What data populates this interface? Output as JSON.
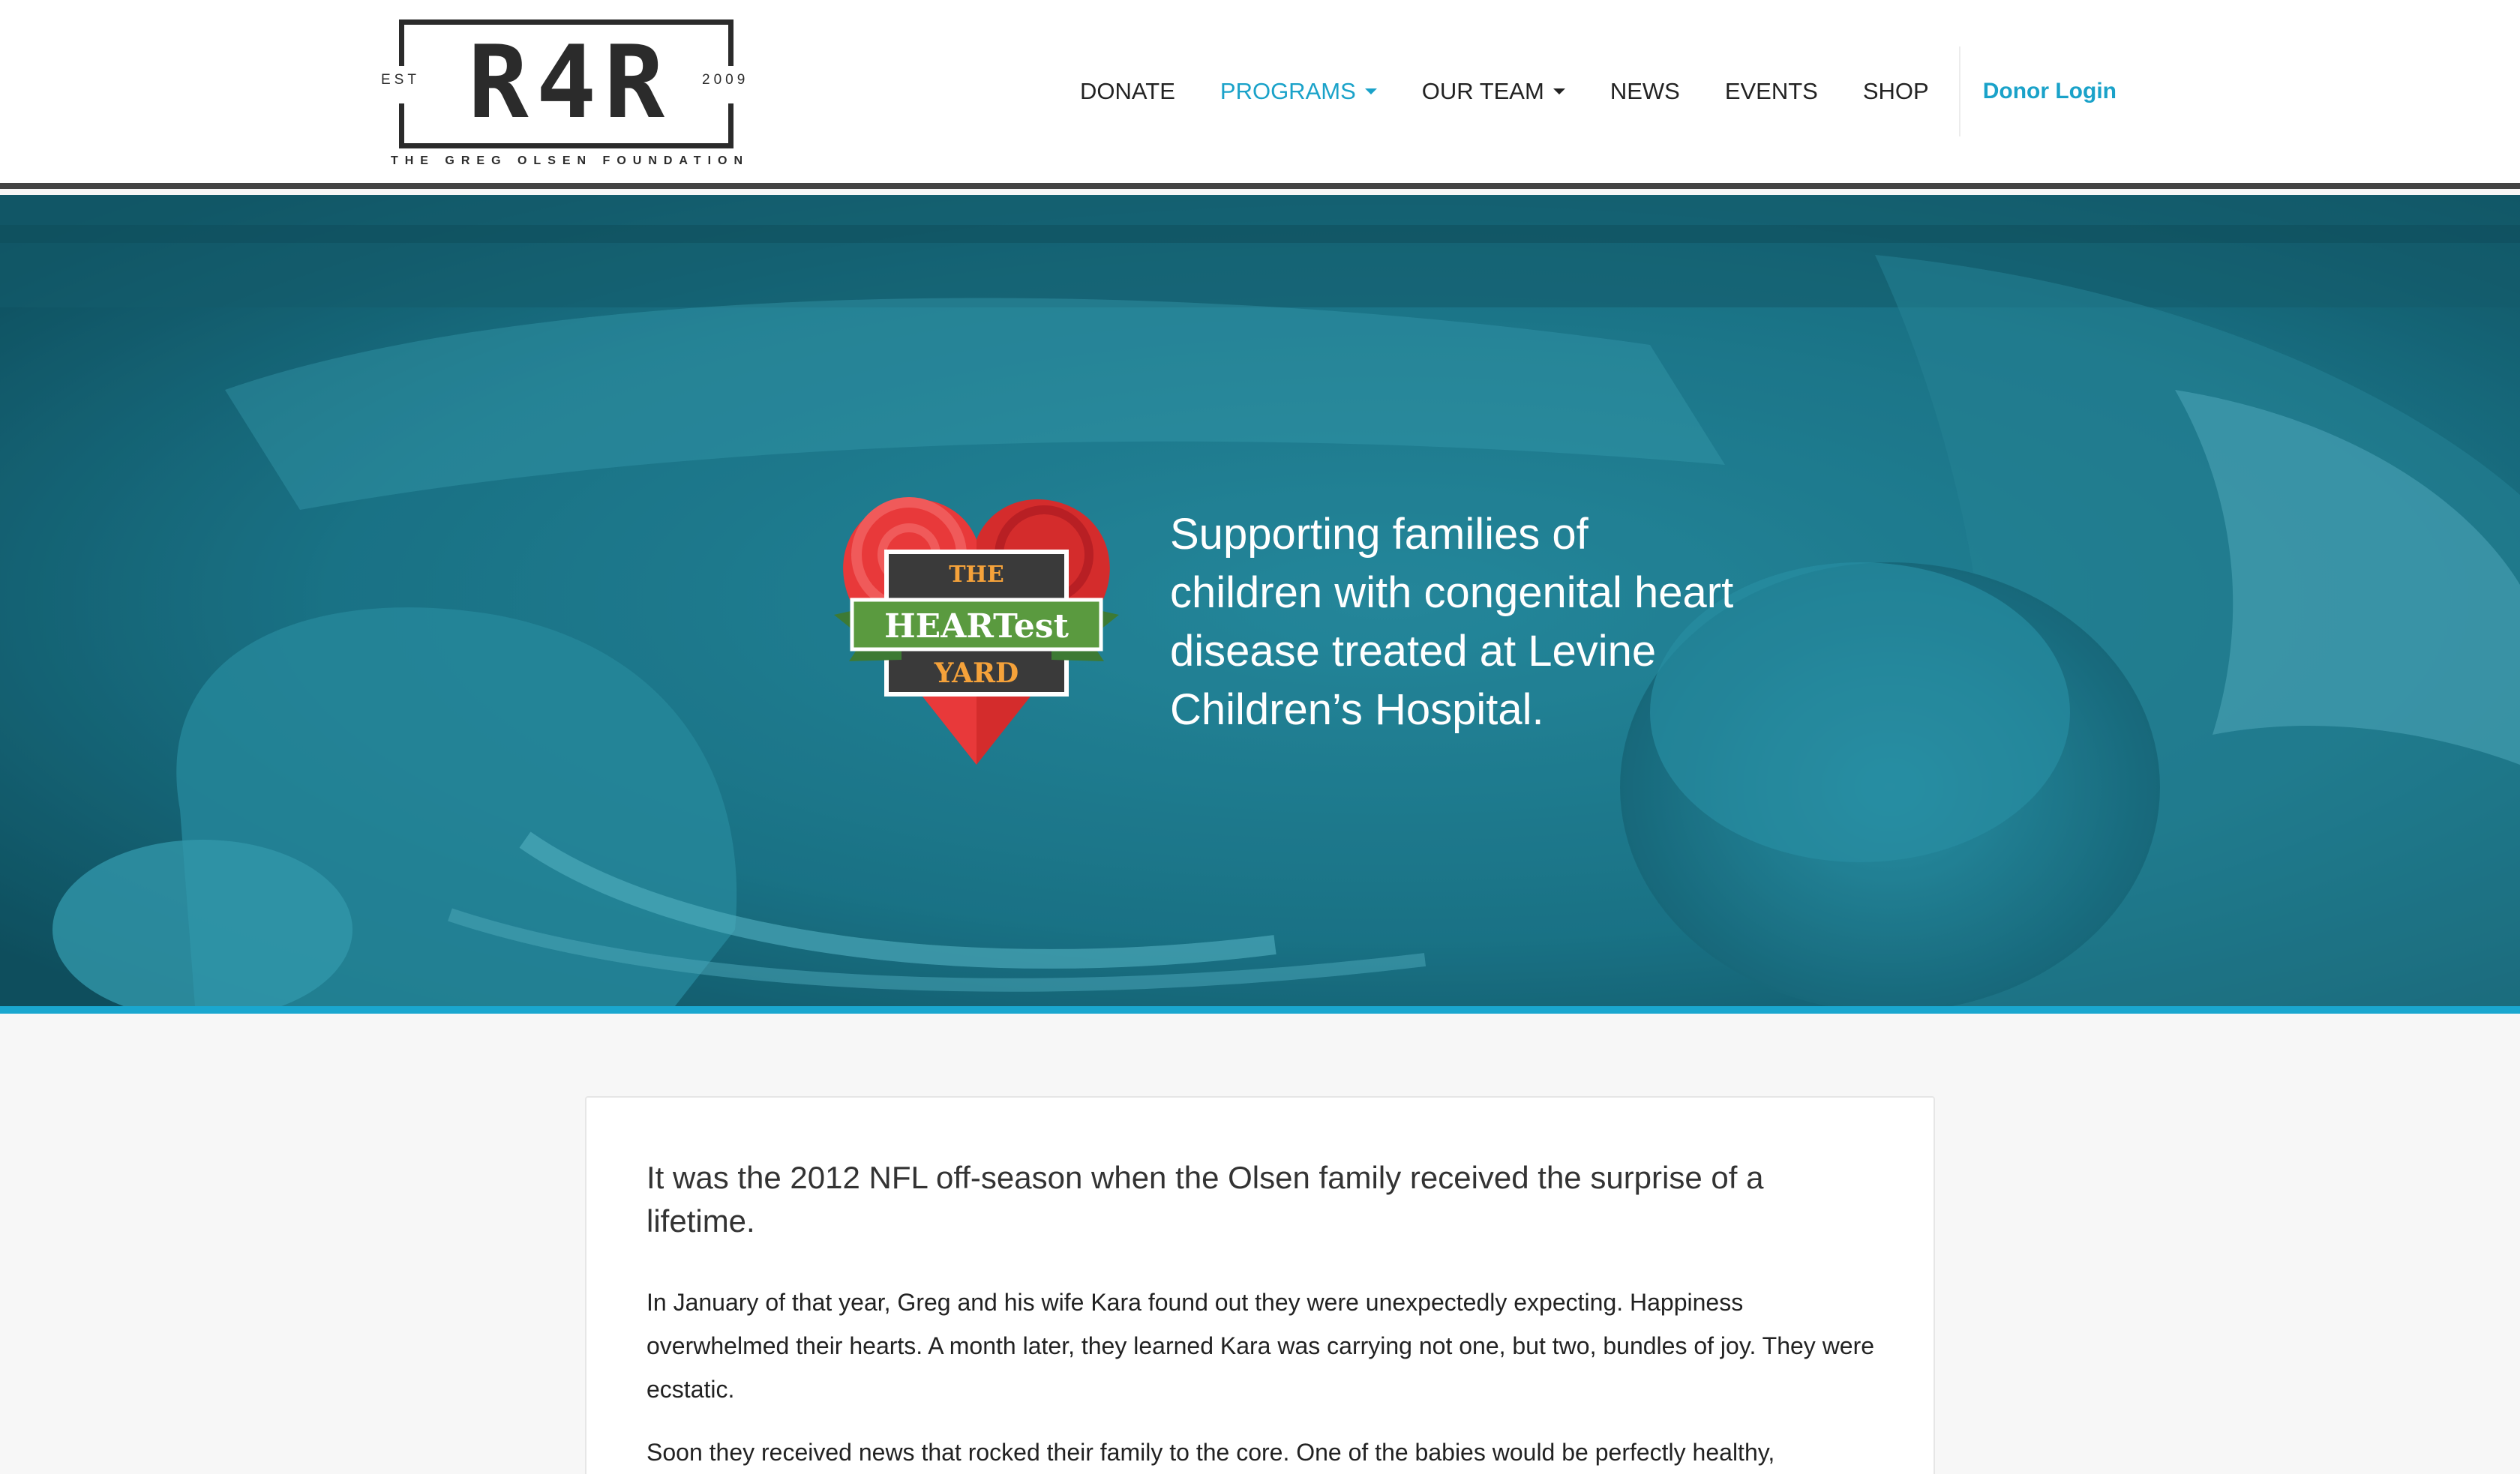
{
  "header": {
    "logo": {
      "mark": "R4R",
      "est": "EST",
      "year": "2009",
      "tagline": "THE GREG OLSEN FOUNDATION"
    },
    "nav": {
      "donate": "DONATE",
      "programs": "PROGRAMS",
      "our_team": "OUR TEAM",
      "news": "NEWS",
      "events": "EVENTS",
      "shop": "SHOP",
      "donor_login": "Donor Login"
    },
    "colors": {
      "accent": "#1aa2c9",
      "nav_text": "#222222"
    }
  },
  "hero": {
    "logo": {
      "line1": "THE",
      "line2": "HEARTest",
      "line3": "YARD"
    },
    "text": "Supporting families of children with congenital heart disease treated at Levine Children’s Hospital.",
    "colors": {
      "overlay": "#1f7d92",
      "bottom_bar": "#1aa7cf"
    }
  },
  "content": {
    "lead": "It was the 2012 NFL off-season when the Olsen family received the surprise of a lifetime.",
    "para1": "In January of that year, Greg and his wife Kara found out they were unexpectedly expecting. Happiness overwhelmed their hearts. A month later, they learned Kara was carrying not one, but two, bundles of joy. They were ecstatic.",
    "para2": "Soon they received news that rocked their family to the core. One of the babies would be perfectly healthy,"
  }
}
